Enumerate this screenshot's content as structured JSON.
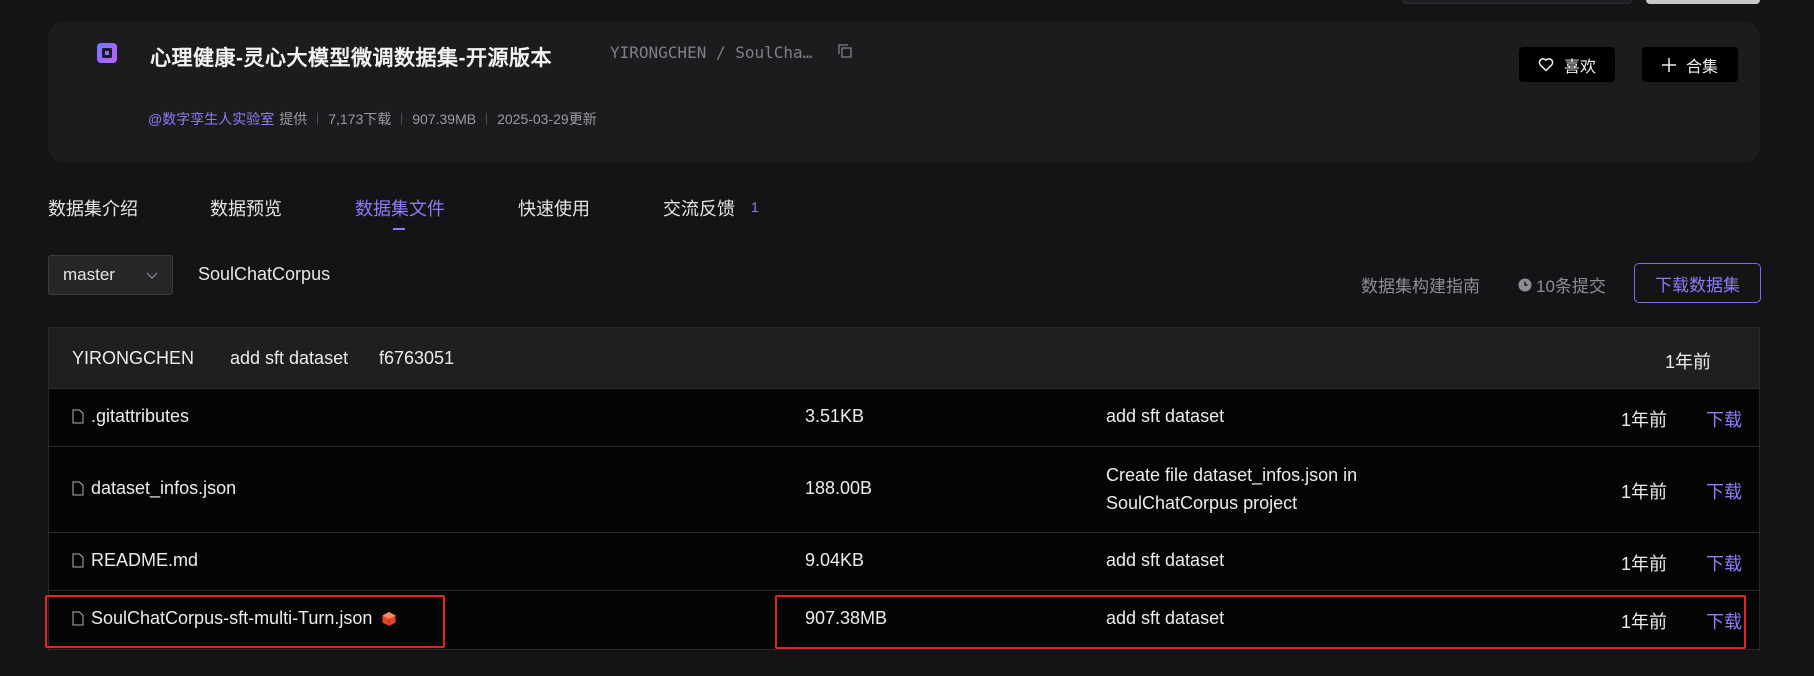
{
  "header": {
    "title": "心理健康-灵心大模型微调数据集-开源版本",
    "repo_path": "YIRONGCHEN / SoulCha…",
    "provider": "@数字孪生人实验室",
    "provided_label": "提供",
    "downloads": "7,173下载",
    "size": "907.39MB",
    "updated": "2025-03-29更新",
    "like_label": "喜欢",
    "collection_label": "合集"
  },
  "tabs": [
    {
      "label": "数据集介绍"
    },
    {
      "label": "数据预览"
    },
    {
      "label": "数据集文件"
    },
    {
      "label": "快速使用"
    },
    {
      "label": "交流反馈"
    }
  ],
  "feedback_count": "1",
  "branch": {
    "selected": "master",
    "path": "SoulChatCorpus"
  },
  "toolbar": {
    "guide_label": "数据集构建指南",
    "commits_label": "10条提交",
    "download_label": "下载数据集"
  },
  "last_commit": {
    "author": "YIRONGCHEN",
    "message": "add sft dataset",
    "hash": "f6763051",
    "time": "1年前"
  },
  "files": [
    {
      "name": ".gitattributes",
      "size": "3.51KB",
      "message": "add sft dataset",
      "time": "1年前",
      "action": "下载"
    },
    {
      "name": "dataset_infos.json",
      "size": "188.00B",
      "message": "Create file dataset_infos.json in SoulChatCorpus project",
      "time": "1年前",
      "action": "下载"
    },
    {
      "name": "README.md",
      "size": "9.04KB",
      "message": "add sft dataset",
      "time": "1年前",
      "action": "下载"
    },
    {
      "name": "SoulChatCorpus-sft-multi-Turn.json",
      "size": "907.38MB",
      "message": "add sft dataset",
      "time": "1年前",
      "action": "下载",
      "lfs": true
    }
  ],
  "colors": {
    "accent": "#8b7cf8",
    "highlight": "#e0261f",
    "background": "#141416"
  },
  "icons": {
    "logo": "dataset-logo-icon",
    "copy": "copy-icon",
    "like": "heart-icon",
    "collection": "plus-icon",
    "branch_chevron": "chevron-down-icon",
    "commits": "clock-icon",
    "file": "file-icon",
    "lfs": "lfs-icon"
  }
}
